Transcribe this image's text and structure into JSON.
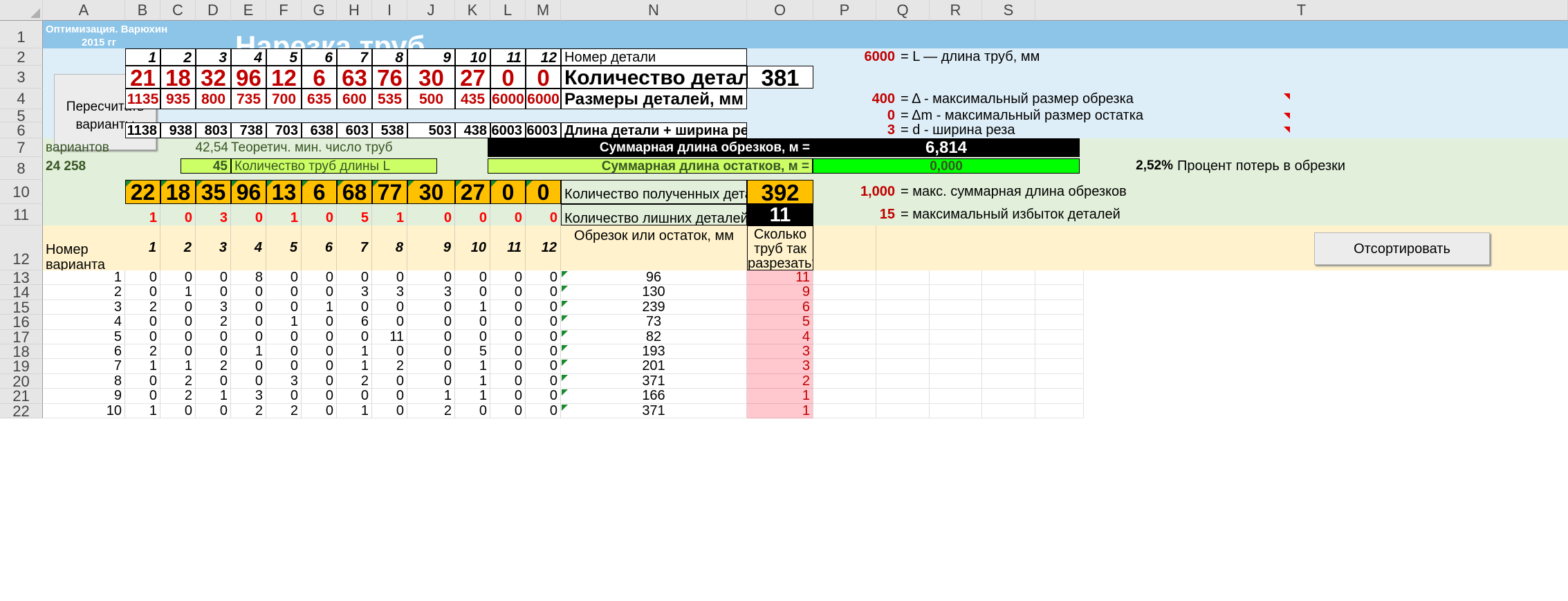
{
  "columns": [
    "A",
    "B",
    "C",
    "D",
    "E",
    "F",
    "G",
    "H",
    "I",
    "J",
    "K",
    "L",
    "M",
    "N",
    "O",
    "P",
    "Q",
    "R",
    "S",
    "T"
  ],
  "rows": [
    "1",
    "2",
    "3",
    "4",
    "5",
    "6",
    "7",
    "8",
    "10",
    "11",
    "12",
    "13",
    "14",
    "15",
    "16",
    "17",
    "18",
    "19",
    "20",
    "21",
    "22"
  ],
  "banner": {
    "author_line1": "Оптимизация.   Варюхин С.Е.",
    "author_line2": "2015 гг",
    "title": "Нарезка труб"
  },
  "recalc_button": {
    "line1": "Пересчитать",
    "line2": "варианты"
  },
  "sort_button": "Отсортировать",
  "part_numbers": [
    "1",
    "2",
    "3",
    "4",
    "5",
    "6",
    "7",
    "8",
    "9",
    "10",
    "11",
    "12"
  ],
  "quantities": [
    "21",
    "18",
    "32",
    "96",
    "12",
    "6",
    "63",
    "76",
    "30",
    "27",
    "0",
    "0"
  ],
  "sizes": [
    "1135",
    "935",
    "800",
    "735",
    "700",
    "635",
    "600",
    "535",
    "500",
    "435",
    "6000",
    "6000"
  ],
  "len_with_cut": [
    "1138",
    "938",
    "803",
    "738",
    "703",
    "638",
    "603",
    "538",
    "503",
    "438",
    "6003",
    "6003"
  ],
  "labels": {
    "part_number": "Номер детали",
    "quantity": "Количество деталей",
    "quantity_total": "381",
    "sizes": "Размеры деталей, мм",
    "len_cut": "Длина детали + ширина реза",
    "variants": "вариантов",
    "variants_count": "24 258",
    "theor_value": "42,54",
    "theor_label": "Теоретич. мин. число труб",
    "pipes_value": "45",
    "pipes_label": "Количество труб длины L",
    "trim_sum_label": "Суммарная длина обрезков, м =",
    "trim_sum_value": "6,814",
    "rem_sum_label": "Суммарная длина остатков, м =",
    "rem_sum_value": "0,000",
    "loss_pct": "2,52%",
    "loss_label": "Процент потерь в обрезки",
    "obtained_label": "Количество полученных  деталей",
    "obtained_total": "392",
    "extra_label": "Количество лишних деталей",
    "extra_total": "11",
    "variant_header": "Номер варианта разреза",
    "trim_header": "Обрезок или остаток, мм",
    "how_many_header": "Сколько труб так разрезать?"
  },
  "params": [
    {
      "value": "6000",
      "label": "= L — длина труб, мм"
    },
    {
      "value": "400",
      "label": "= Δ - максимальный размер обрезка"
    },
    {
      "value": "0",
      "label": "= Δm - максимальный размер остатка"
    },
    {
      "value": "3",
      "label": "= d - ширина реза"
    },
    {
      "value": "1,000",
      "label": "= макс. суммарная длина обрезков"
    },
    {
      "value": "15",
      "label": "= максимальный избыток деталей"
    }
  ],
  "obtained": [
    "22",
    "18",
    "35",
    "96",
    "13",
    "6",
    "68",
    "77",
    "30",
    "27",
    "0",
    "0"
  ],
  "extra": [
    "1",
    "0",
    "3",
    "0",
    "1",
    "0",
    "5",
    "1",
    "0",
    "0",
    "0",
    "0"
  ],
  "variants_table": [
    {
      "n": "1",
      "v": [
        "0",
        "0",
        "0",
        "8",
        "0",
        "0",
        "0",
        "0",
        "0",
        "0",
        "0",
        "0"
      ],
      "trim": "96",
      "count": "11"
    },
    {
      "n": "2",
      "v": [
        "0",
        "1",
        "0",
        "0",
        "0",
        "0",
        "3",
        "3",
        "3",
        "0",
        "0",
        "0"
      ],
      "trim": "130",
      "count": "9"
    },
    {
      "n": "3",
      "v": [
        "2",
        "0",
        "3",
        "0",
        "0",
        "1",
        "0",
        "0",
        "0",
        "1",
        "0",
        "0"
      ],
      "trim": "239",
      "count": "6"
    },
    {
      "n": "4",
      "v": [
        "0",
        "0",
        "2",
        "0",
        "1",
        "0",
        "6",
        "0",
        "0",
        "0",
        "0",
        "0"
      ],
      "trim": "73",
      "count": "5"
    },
    {
      "n": "5",
      "v": [
        "0",
        "0",
        "0",
        "0",
        "0",
        "0",
        "0",
        "11",
        "0",
        "0",
        "0",
        "0"
      ],
      "trim": "82",
      "count": "4"
    },
    {
      "n": "6",
      "v": [
        "2",
        "0",
        "0",
        "1",
        "0",
        "0",
        "1",
        "0",
        "0",
        "5",
        "0",
        "0"
      ],
      "trim": "193",
      "count": "3"
    },
    {
      "n": "7",
      "v": [
        "1",
        "1",
        "2",
        "0",
        "0",
        "0",
        "1",
        "2",
        "0",
        "1",
        "0",
        "0"
      ],
      "trim": "201",
      "count": "3"
    },
    {
      "n": "8",
      "v": [
        "0",
        "2",
        "0",
        "0",
        "3",
        "0",
        "2",
        "0",
        "0",
        "1",
        "0",
        "0"
      ],
      "trim": "371",
      "count": "2"
    },
    {
      "n": "9",
      "v": [
        "0",
        "2",
        "1",
        "3",
        "0",
        "0",
        "0",
        "0",
        "1",
        "1",
        "0",
        "0"
      ],
      "trim": "166",
      "count": "1"
    },
    {
      "n": "10",
      "v": [
        "1",
        "0",
        "0",
        "2",
        "2",
        "0",
        "1",
        "0",
        "2",
        "0",
        "0",
        "0"
      ],
      "trim": "371",
      "count": "1"
    }
  ],
  "colors": {
    "banner": "#8dc5e8",
    "light_blue": "#deeef8",
    "light_green": "#e2efda",
    "orange": "#ffc000",
    "cream": "#fff2cc",
    "pink": "#ffc7ce",
    "bright_green": "#00ff00",
    "lime": "#ccff66",
    "dark_red": "#c00000",
    "red": "#ff0000"
  }
}
